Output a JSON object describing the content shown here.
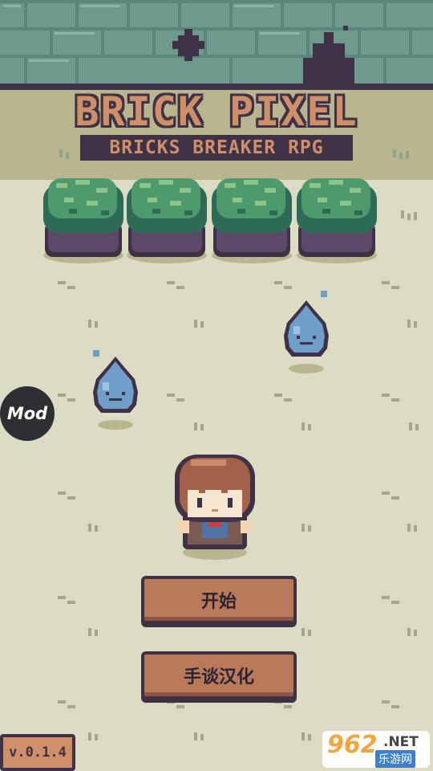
{
  "title": {
    "main": "BRICK PIXEL",
    "subtitle": "BRICKS BREAKER RPG"
  },
  "menu": {
    "start_label": "开始",
    "localization_label": "手谈汉化"
  },
  "badge": {
    "mod_label": "Mod"
  },
  "version": "v.0.1.4",
  "watermark": {
    "number": "962",
    "domain": ".NET",
    "cn_name": "乐游网"
  },
  "colors": {
    "wall": "#6e9a8e",
    "grass": "#dcdcc4",
    "button": "#b97a5a",
    "outline": "#3f3146",
    "logo_text": "#cf9069"
  }
}
